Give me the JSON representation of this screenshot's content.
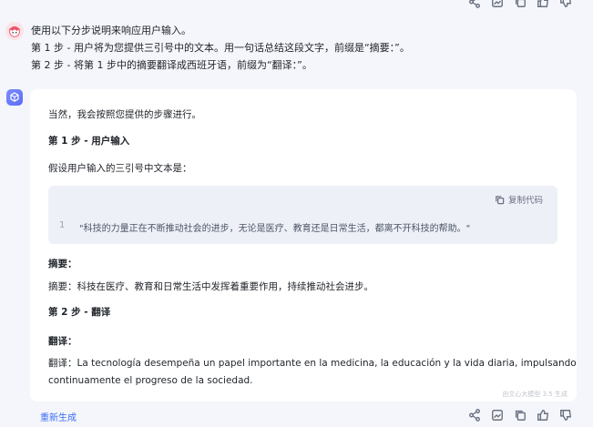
{
  "user_message": {
    "lines": [
      "使用以下分步说明来响应用户输入。",
      "第 1 步 - 用户将为您提供三引号中的文本。用一句话总结这段文字，前缀是“摘要：”。",
      "第 2 步 - 将第 1 步中的摘要翻译成西班牙语，前缀为“翻译：”。"
    ]
  },
  "response": {
    "intro": "当然，我会按照您提供的步骤进行。",
    "step1_title": "第 1 步 - 用户输入",
    "step1_text": "假设用户输入的三引号中文本是：",
    "code": {
      "copy_label": "复制代码",
      "line_number": "1",
      "line": "\"科技的力量正在不断推动社会的进步，无论是医疗、教育还是日常生活，都离不开科技的帮助。\""
    },
    "summary_heading": "摘要：",
    "summary_text": "摘要：科技在医疗、教育和日常生活中发挥着重要作用，持续推动社会进步。",
    "step2_title": "第 2 步 - 翻译",
    "translation_heading": "翻译：",
    "translation_line1": "翻译：La tecnología desempeña un papel importante en la medicina, la educación y la vida diaria, impulsando",
    "translation_line2": "continuamente el progreso de la sociedad.",
    "watermark": "由文心大模型 3.5 生成"
  },
  "footer": {
    "regenerate_label": "重新生成"
  },
  "icons": {
    "actions": [
      "share-icon",
      "image-icon",
      "copy-icon",
      "thumbs-up-icon",
      "thumbs-down-icon"
    ]
  }
}
